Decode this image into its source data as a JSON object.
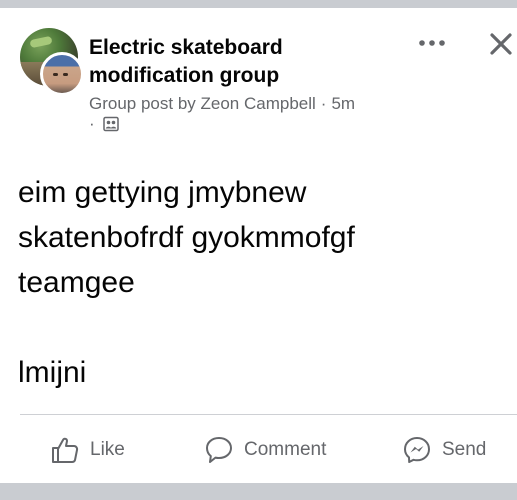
{
  "post": {
    "group_name": "Electric skateboard modification group",
    "meta": {
      "prefix": "Group post by",
      "author": "Zeon Campbell",
      "separator": "·",
      "time": "5m",
      "privacy_separator": "·",
      "privacy_icon": "group-members-icon"
    },
    "body": {
      "line1": "eim gettying jmybnew",
      "line2": "skatenbofrdf gyokmmofgf",
      "line3": "teamgee",
      "line4": "lmijni"
    },
    "menu_icon": "more-horizontal-icon",
    "close_icon": "close-icon"
  },
  "actions": {
    "like": {
      "label": "Like",
      "icon": "thumbs-up-icon"
    },
    "comment": {
      "label": "Comment",
      "icon": "speech-bubble-icon"
    },
    "send": {
      "label": "Send",
      "icon": "messenger-icon"
    }
  },
  "colors": {
    "text_primary": "#050505",
    "text_secondary": "#65676b",
    "background_outer": "#c9ccd1",
    "card": "#ffffff",
    "divider": "#ced0d4"
  }
}
